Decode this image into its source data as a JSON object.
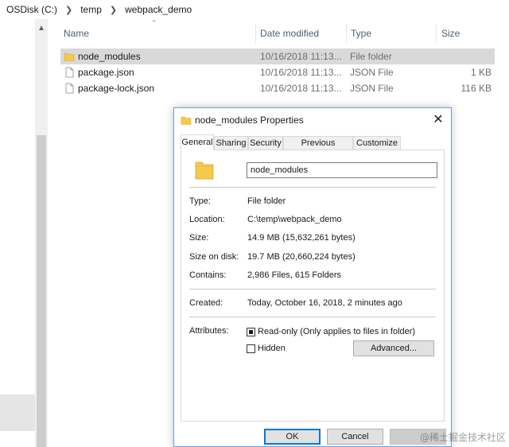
{
  "explorer": {
    "breadcrumb": [
      "OSDisk (C:)",
      "temp",
      "webpack_demo"
    ],
    "columns": {
      "name": "Name",
      "date_modified": "Date modified",
      "type": "Type",
      "size": "Size"
    },
    "files": [
      {
        "name": "node_modules",
        "date": "10/16/2018 11:13...",
        "type": "File folder",
        "size": "",
        "icon": "folder-icon",
        "selected": true
      },
      {
        "name": "package.json",
        "date": "10/16/2018 11:13...",
        "type": "JSON File",
        "size": "1 KB",
        "icon": "file-icon",
        "selected": false
      },
      {
        "name": "package-lock.json",
        "date": "10/16/2018 11:13...",
        "type": "JSON File",
        "size": "116 KB",
        "icon": "file-icon",
        "selected": false
      }
    ]
  },
  "dialog": {
    "title": "node_modules Properties",
    "close_icon": "close-icon",
    "tabs": [
      "General",
      "Sharing",
      "Security",
      "Previous Versions",
      "Customize"
    ],
    "active_tab": "General",
    "name_value": "node_modules",
    "type_label": "Type:",
    "type_value": "File folder",
    "location_label": "Location:",
    "location_value": "C:\\temp\\webpack_demo",
    "size_label": "Size:",
    "size_value": "14.9 MB (15,632,261 bytes)",
    "size_on_disk_label": "Size on disk:",
    "size_on_disk_value": "19.7 MB (20,660,224 bytes)",
    "contains_label": "Contains:",
    "contains_value": "2,986 Files, 615 Folders",
    "created_label": "Created:",
    "created_value": "Today, October 16, 2018, 2 minutes ago",
    "attributes_label": "Attributes:",
    "readonly_label": "Read-only (Only applies to files in folder)",
    "readonly_state": "indeterminate",
    "hidden_label": "Hidden",
    "hidden_checked": false,
    "advanced_button": "Advanced...",
    "ok_button": "OK",
    "cancel_button": "Cancel"
  },
  "watermark": "@稀土掘金技术社区",
  "colors": {
    "folder": "#f4c94e",
    "selection": "#d9d9d9",
    "header_text": "#4c607a",
    "dialog_border": "#6f9ed1",
    "accent": "#0078d7"
  }
}
